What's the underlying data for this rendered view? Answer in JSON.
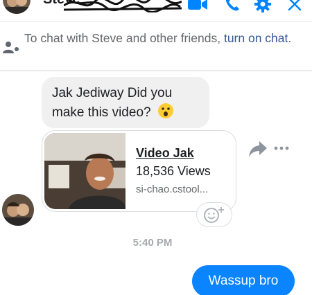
{
  "header": {
    "contact_name": "Steve",
    "icons": [
      "video-call-icon",
      "phone-icon",
      "gear-icon",
      "close-icon"
    ],
    "accent_color": "#0084ff"
  },
  "notice": {
    "text": "To chat with Steve and other friends, ",
    "link": "turn on chat",
    "suffix": "."
  },
  "messages": {
    "incoming_text": "Jak Jediway Did you make this video?",
    "incoming_emoji": "surprised-face",
    "link_card": {
      "title": "Video Jak",
      "views": "18,536 Views",
      "domain": "si-chao.cstool..."
    },
    "timestamp": "5:40 PM",
    "outgoing_text": "Wassup bro",
    "outgoing_color": "#0a84ff"
  }
}
